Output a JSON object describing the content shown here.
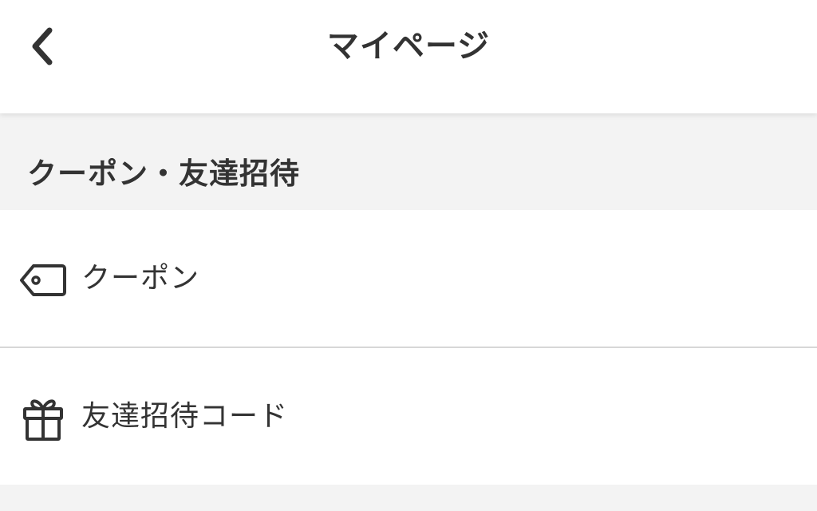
{
  "header": {
    "back_icon": "chevron-left-icon",
    "title": "マイページ"
  },
  "section": {
    "title": "クーポン・友達招待"
  },
  "items": [
    {
      "icon": "tag-icon",
      "label": "クーポン"
    },
    {
      "icon": "gift-icon",
      "label": "友達招待コード"
    }
  ],
  "colors": {
    "text": "#333333",
    "background": "#f3f3f3",
    "surface": "#ffffff",
    "divider": "#d7d7d7"
  }
}
